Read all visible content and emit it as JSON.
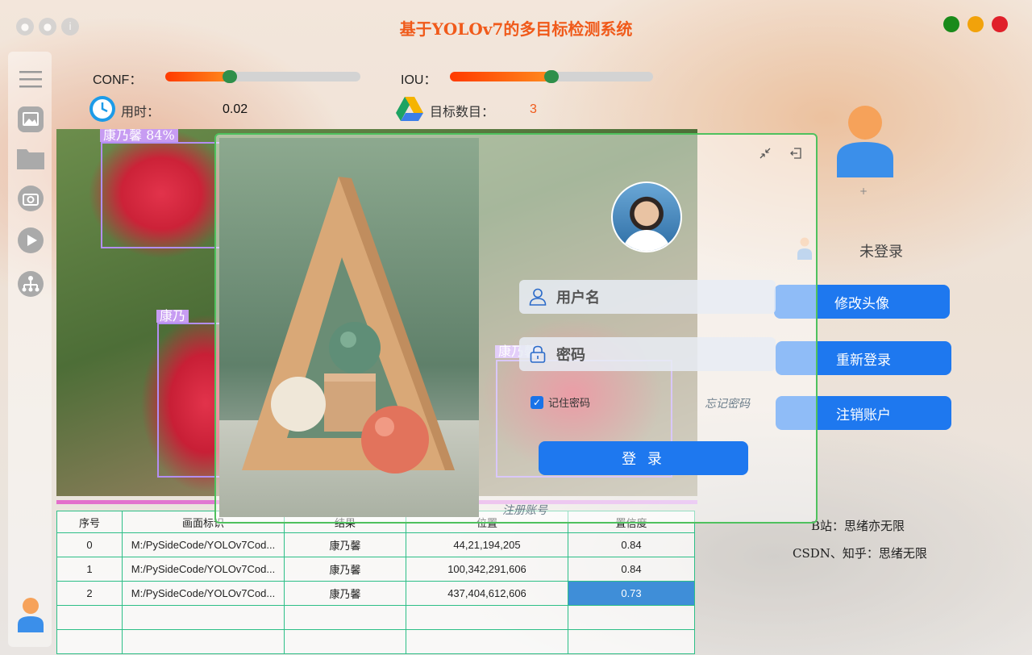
{
  "app": {
    "title": "基于YOLOv7的多目标检测系统"
  },
  "colors": {
    "accent": "#1e78ef",
    "title": "#f05a1a",
    "close": "#e0202a",
    "minimize": "#f2a20a",
    "maximize": "#1a8a1a"
  },
  "controls": {
    "conf_label": "CONF：",
    "conf_value": 0.33,
    "iou_label": "IOU：",
    "iou_value": 0.5,
    "time_label": "用时：",
    "time_value": "0.02",
    "count_label": "目标数目：",
    "count_value": "3"
  },
  "detections": [
    {
      "label": "康乃馨 84%"
    },
    {
      "label": "康乃馨"
    },
    {
      "label": "康乃"
    }
  ],
  "table": {
    "headers": [
      "序号",
      "画面标识",
      "结果",
      "位置",
      "置信度"
    ],
    "rows": [
      [
        "0",
        "M:/PySideCode/YOLOv7Cod...",
        "康乃馨",
        "44,21,194,205",
        "0.84"
      ],
      [
        "1",
        "M:/PySideCode/YOLOv7Cod...",
        "康乃馨",
        "100,342,291,606",
        "0.84"
      ],
      [
        "2",
        "M:/PySideCode/YOLOv7Cod...",
        "康乃馨",
        "437,404,612,606",
        "0.73"
      ],
      [
        "",
        "",
        "",
        "",
        ""
      ],
      [
        "",
        "",
        "",
        "",
        ""
      ]
    ]
  },
  "login": {
    "username_placeholder": "用户名",
    "password_placeholder": "密码",
    "remember_label": "记住密码",
    "forgot_label": "忘记密码",
    "login_label": "登 录",
    "register_label": "注册账号"
  },
  "user_panel": {
    "plus": "+",
    "status": "未登录",
    "change_avatar": "修改头像",
    "relogin": "重新登录",
    "logout": "注销账户"
  },
  "credits": {
    "bilibili": "B站：思绪亦无限",
    "csdn": "CSDN、知乎：思绪无限"
  }
}
